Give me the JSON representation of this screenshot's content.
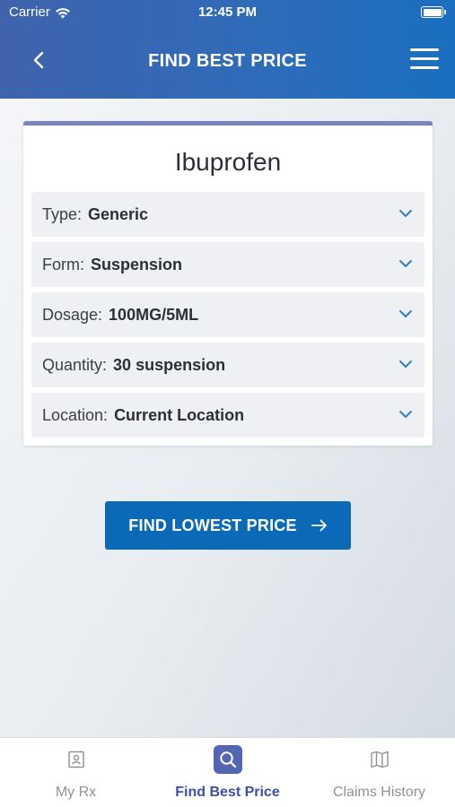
{
  "status_bar": {
    "carrier": "Carrier",
    "time": "12:45 PM"
  },
  "header": {
    "title": "FIND BEST PRICE"
  },
  "drug": {
    "name": "Ibuprofen",
    "fields": [
      {
        "label": "Type:",
        "value": "Generic"
      },
      {
        "label": "Form:",
        "value": "Suspension"
      },
      {
        "label": "Dosage:",
        "value": "100MG/5ML"
      },
      {
        "label": "Quantity:",
        "value": "30 suspension"
      },
      {
        "label": "Location:",
        "value": "Current Location"
      }
    ]
  },
  "cta": {
    "label": "FIND LOWEST PRICE"
  },
  "tabs": [
    {
      "label": "My Rx",
      "icon": "contact-card-icon",
      "active": false
    },
    {
      "label": "Find Best Price",
      "icon": "search-icon",
      "active": true
    },
    {
      "label": "Claims History",
      "icon": "map-icon",
      "active": false
    }
  ],
  "colors": {
    "header": "#2f6bb8",
    "button": "#0a6ab8",
    "active_tab": "#3f4ea8",
    "card_accent": "#7b83bc"
  }
}
